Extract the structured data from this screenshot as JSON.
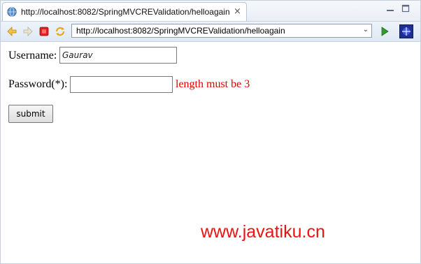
{
  "tab": {
    "title": "http://localhost:8082/SpringMVCREValidation/helloagain",
    "close_glyph": "×"
  },
  "window": {
    "minimize_icon": "minimize-icon",
    "maximize_icon": "maximize-icon"
  },
  "toolbar": {
    "back_icon": "back-arrow-icon",
    "forward_icon": "forward-arrow-icon",
    "stop_icon": "stop-icon",
    "refresh_icon": "refresh-icon",
    "url": "http://localhost:8082/SpringMVCREValidation/helloagain",
    "dropdown_glyph": "⌄",
    "go_icon": "go-icon",
    "eclipse_icon": "eclipse-icon"
  },
  "form": {
    "username_label": "Username:",
    "username_value": "Gaurav",
    "password_label": "Password(*):",
    "password_value": "",
    "password_error": "length must be 3",
    "submit_label": "submit"
  },
  "watermark": "www.javatiku.cn",
  "colors": {
    "error": "#e00000",
    "watermark": "#ee1111",
    "stop_icon": "#e02020",
    "go_icon": "#2f9e2f"
  }
}
